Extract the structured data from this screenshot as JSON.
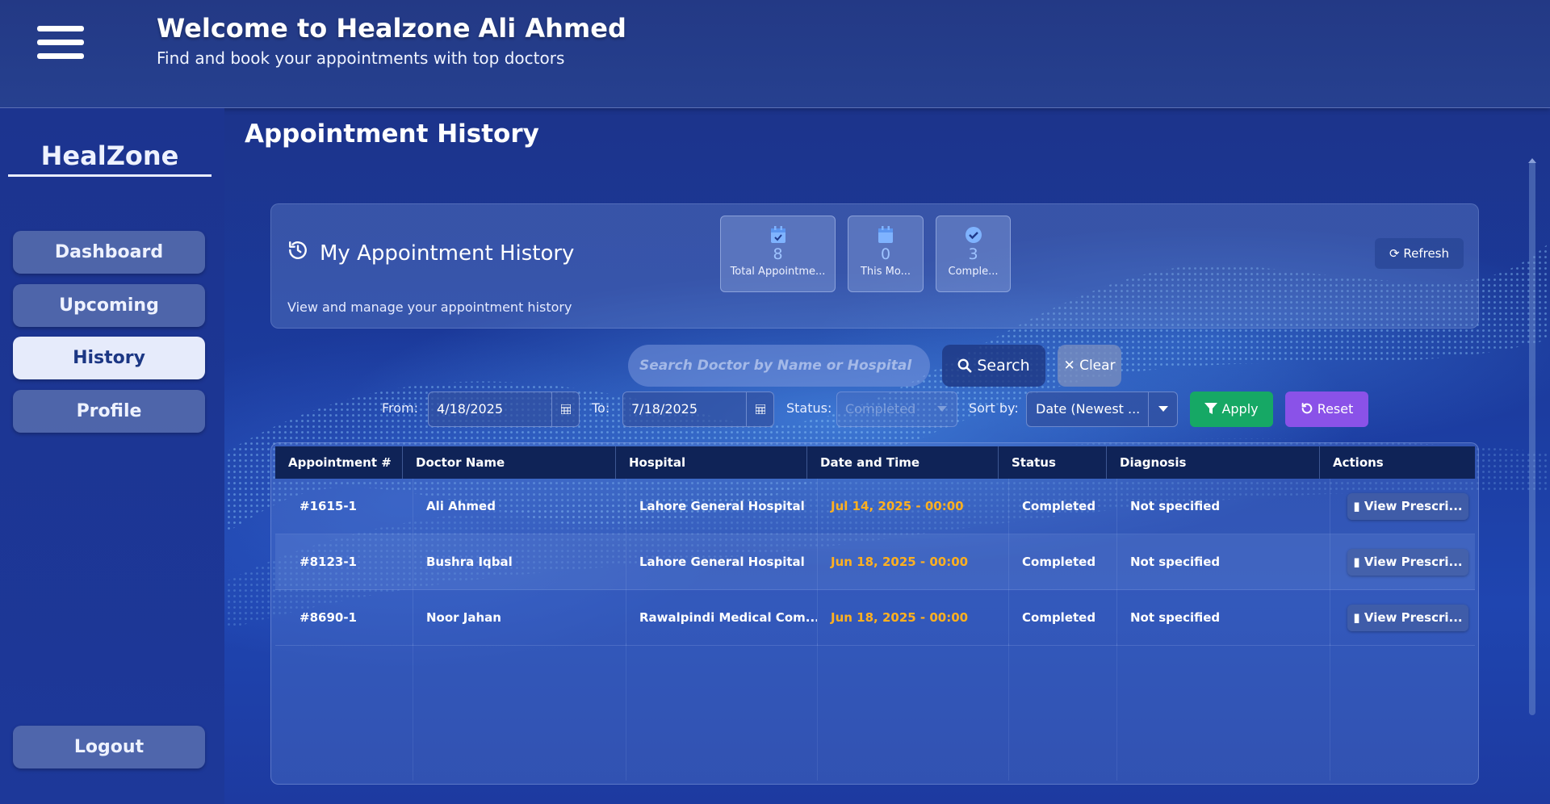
{
  "header": {
    "welcome": "Welcome to Healzone",
    "user_name": "Ali Ahmed",
    "subtitle": "Find and book your appointments with top doctors"
  },
  "sidebar": {
    "brand": "HealZone",
    "items": [
      {
        "label": "Dashboard",
        "active": false
      },
      {
        "label": "Upcoming",
        "active": false
      },
      {
        "label": "History",
        "active": true
      },
      {
        "label": "Profile",
        "active": false
      }
    ],
    "logout_label": "Logout"
  },
  "page": {
    "title": "Appointment History"
  },
  "summary": {
    "title": "My Appointment History",
    "subtitle": "View and manage your appointment history",
    "stats": [
      {
        "value": "8",
        "label": "Total Appointme...",
        "icon": "calendar-check-icon"
      },
      {
        "value": "0",
        "label": "This Mo...",
        "icon": "calendar-icon"
      },
      {
        "value": "3",
        "label": "Comple...",
        "icon": "check-circle-icon"
      }
    ],
    "refresh_label": "Refresh"
  },
  "search": {
    "placeholder": "Search Doctor by Name or Hospital",
    "value": "",
    "search_label": "Search",
    "clear_label": "Clear"
  },
  "filters": {
    "from_label": "From:",
    "from_value": "4/18/2025",
    "to_label": "To:",
    "to_value": "7/18/2025",
    "status_label": "Status:",
    "status_value": "Completed",
    "sort_label": "Sort by:",
    "sort_value": "Date (Newest ...",
    "apply_label": "Apply",
    "reset_label": "Reset"
  },
  "table": {
    "columns": [
      "Appointment #",
      "Doctor Name",
      "Hospital",
      "Date and Time",
      "Status",
      "Diagnosis",
      "Actions"
    ],
    "rows": [
      {
        "id": "#1615-1",
        "doctor": "Ali Ahmed",
        "hospital": "Lahore General Hospital",
        "datetime": "Jul 14, 2025 - 00:00",
        "status": "Completed",
        "diagnosis": "Not specified",
        "action": "View Prescri..."
      },
      {
        "id": "#8123-1",
        "doctor": "Bushra Iqbal",
        "hospital": "Lahore General Hospital",
        "datetime": "Jun 18, 2025 - 00:00",
        "status": "Completed",
        "diagnosis": "Not specified",
        "action": "View Prescri..."
      },
      {
        "id": "#8690-1",
        "doctor": "Noor Jahan",
        "hospital": "Rawalpindi Medical Com...",
        "datetime": "Jun 18, 2025 - 00:00",
        "status": "Completed",
        "diagnosis": "Not specified",
        "action": "View Prescri..."
      }
    ]
  },
  "colors": {
    "background": "#1a2f86",
    "header": "#233985",
    "accent_date": "#ffb020",
    "apply": "#16a865",
    "reset": "#8a52e8",
    "table_header": "#0f2357",
    "active_nav": "#e6ebfb"
  }
}
